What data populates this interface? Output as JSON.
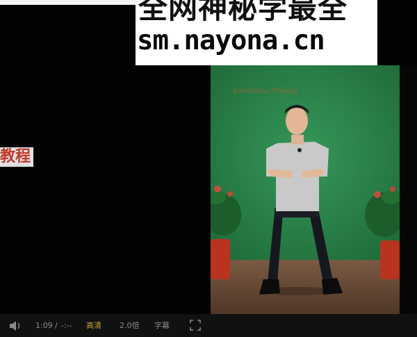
{
  "overlay": {
    "banner_line1": "全网神秘学最全",
    "banner_line2": "sm.nayona.cn",
    "left_tag": "教程"
  },
  "video": {
    "title_overlay": "Kornfortnu Trinong"
  },
  "controls": {
    "current_time": "1:09",
    "separator": "/",
    "total_time": "-:--",
    "quality_label": "高清",
    "speed_label": "2.0倍",
    "subtitle_label": "字幕"
  },
  "colors": {
    "green_screen": "#2f8a4c",
    "floor": "#6b4a36",
    "quality_active": "#c9a23b"
  }
}
